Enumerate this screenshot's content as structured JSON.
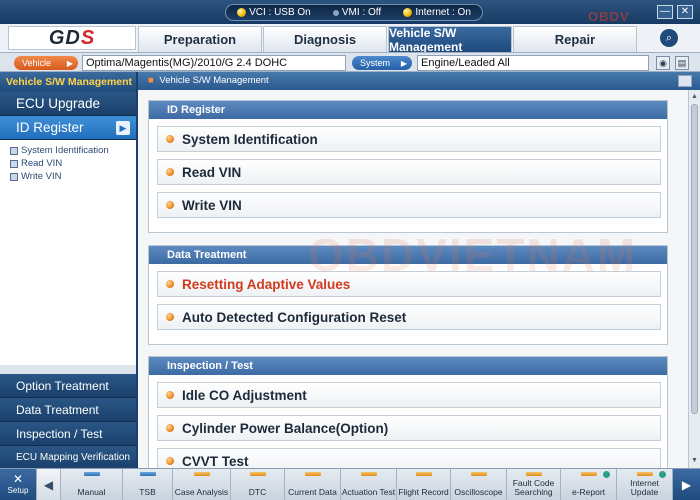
{
  "status": {
    "vci": "VCI : USB On",
    "vmi": "VMI : Off",
    "internet": "Internet : On"
  },
  "brand_watermark": "OBDV",
  "logo": {
    "main": "GD",
    "accent": "S"
  },
  "window_controls": [
    "—",
    "✕"
  ],
  "tabs": [
    {
      "label": "Preparation",
      "active": false
    },
    {
      "label": "Diagnosis",
      "active": false
    },
    {
      "label": "Vehicle S/W Management",
      "active": true
    },
    {
      "label": "Repair",
      "active": false
    }
  ],
  "vehicle_bar": {
    "vehicle_label": "Vehicle",
    "vehicle_value": "Optima/Magentis(MG)/2010/G 2.4 DOHC",
    "system_label": "System",
    "system_value": "Engine/Leaded All"
  },
  "sidebar": {
    "heading": "Vehicle S/W Management",
    "items": [
      {
        "label": "ECU Upgrade"
      },
      {
        "label": "ID Register"
      }
    ],
    "subitems": [
      {
        "label": "System Identification"
      },
      {
        "label": "Read VIN"
      },
      {
        "label": "Write VIN"
      }
    ],
    "bottom_items": [
      {
        "label": "Option Treatment"
      },
      {
        "label": "Data Treatment"
      },
      {
        "label": "Inspection / Test"
      },
      {
        "label": "ECU Mapping Verification"
      }
    ]
  },
  "breadcrumb": "Vehicle S/W Management",
  "sections": [
    {
      "title": "ID Register",
      "rows": [
        "System Identification",
        "Read VIN",
        "Write VIN"
      ]
    },
    {
      "title": "Data Treatment",
      "rows": [
        "Resetting Adaptive Values",
        "Auto Detected Configuration Reset"
      ]
    },
    {
      "title": "Inspection / Test",
      "rows": [
        "Idle CO Adjustment",
        "Cylinder Power Balance(Option)",
        "CVVT Test"
      ]
    }
  ],
  "content_watermark": "OBDVIETNAM",
  "toolbar": {
    "setup": "Setup",
    "tools": [
      {
        "label": "Manual"
      },
      {
        "label": "TSB"
      },
      {
        "label": "Case Analysis"
      },
      {
        "label": "DTC"
      },
      {
        "label": "Current Data"
      },
      {
        "label": "Actuation Test"
      },
      {
        "label": "Flight Record"
      },
      {
        "label": "Oscilloscope"
      },
      {
        "label": "Fault Code Searching"
      },
      {
        "label": "e-Report"
      },
      {
        "label": "Internet Update"
      }
    ]
  },
  "colors": {
    "accent_blue": "#1e4a7c",
    "highlight_red": "#d23a1e",
    "status_amber": "#f0b400"
  }
}
